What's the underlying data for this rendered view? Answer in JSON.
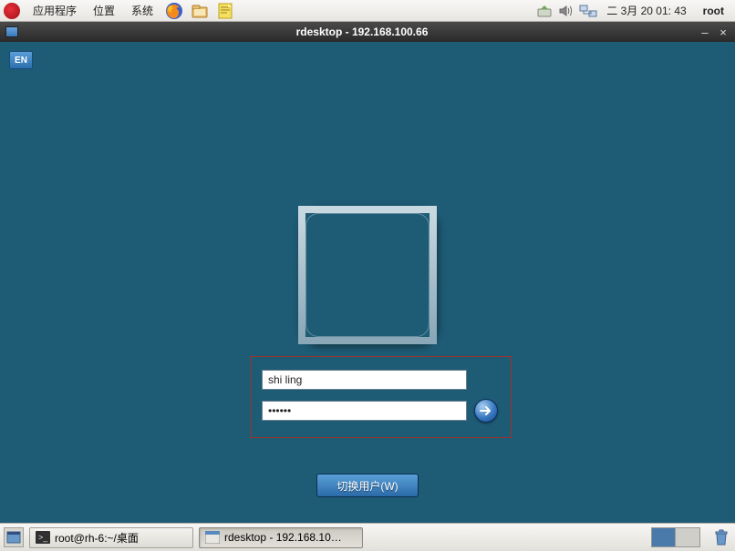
{
  "top_panel": {
    "menus": [
      "应用程序",
      "位置",
      "系统"
    ],
    "datetime": "二  3月  20 01: 43",
    "user": "root"
  },
  "window": {
    "title": "rdesktop - 192.168.100.66"
  },
  "rdp": {
    "lang": "EN",
    "username": "shi ling",
    "password": "••••••",
    "switch_user": "切换用户(W)"
  },
  "taskbar": {
    "task1": "root@rh-6:~/桌面",
    "task2": "rdesktop - 192.168.10…"
  }
}
